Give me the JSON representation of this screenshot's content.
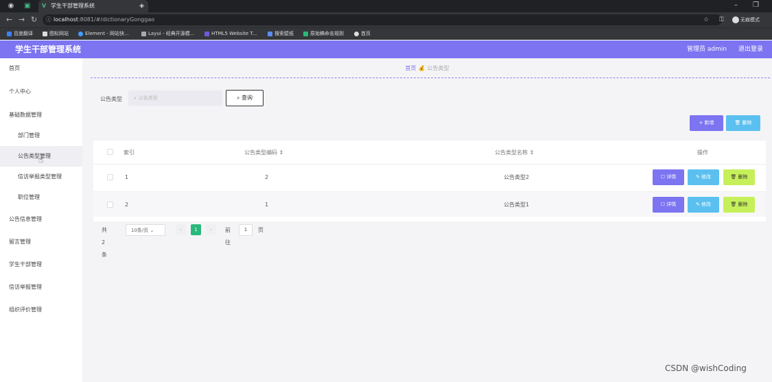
{
  "browser": {
    "tab_title": "学生干部管理系统",
    "tab_close": "×",
    "new_tab": "+",
    "url_host": "localhost",
    "url_path": ":8081/#/dictionaryGonggao",
    "profile_label": "无痕模式",
    "bookmarks": [
      "百度翻译",
      "图标网站",
      "Element - 网站快...",
      "Layui - 经典开源模...",
      "HTML5 Website T...",
      "搜索壁纸",
      "原始稿命名规则",
      "首页"
    ]
  },
  "header": {
    "title": "学生干部管理系统",
    "user": "管理员 admin",
    "logout": "退出登录"
  },
  "sidebar": {
    "items": [
      {
        "label": "首页"
      },
      {
        "label": "个人中心"
      },
      {
        "label": "基础数据管理"
      },
      {
        "label": "部门管理"
      },
      {
        "label": "公告类型管理"
      },
      {
        "label": "信访举报类型管理"
      },
      {
        "label": "职位管理"
      },
      {
        "label": "公告信息管理"
      },
      {
        "label": "留言管理"
      },
      {
        "label": "学生干部管理"
      },
      {
        "label": "信访举报管理"
      },
      {
        "label": "组织评价管理"
      }
    ]
  },
  "breadcrumb": {
    "home": "首页",
    "separator": "💰",
    "current": "公告类型"
  },
  "search": {
    "label": "公告类型",
    "placeholder": "公告类型",
    "query_button": "查询"
  },
  "toolbar": {
    "add_label": "+ 新增",
    "delete_label": "🗑 删除"
  },
  "table": {
    "headers": {
      "index": "索引",
      "code": "公告类型编码 ⇕",
      "name": "公告类型名称 ⇕",
      "actions": "操作"
    },
    "rows": [
      {
        "index": "1",
        "code": "2",
        "name": "公告类型2"
      },
      {
        "index": "2",
        "code": "1",
        "name": "公告类型1"
      }
    ],
    "row_actions": {
      "detail": "☐ 详情",
      "edit": "✎ 修改",
      "delete": "🗑 删除"
    }
  },
  "pagination": {
    "total": "共 2 条",
    "page_size": "10条/页",
    "prev": "‹",
    "current_page": "1",
    "next": "›",
    "goto_label": "前往",
    "goto_value": "1",
    "page_suffix": "页"
  },
  "watermark": "CSDN @wishCoding",
  "colors": {
    "accent": "#7c74f0",
    "info": "#5bc0f0",
    "warning_green": "#c6f05a",
    "page_active": "#2ab87a"
  }
}
